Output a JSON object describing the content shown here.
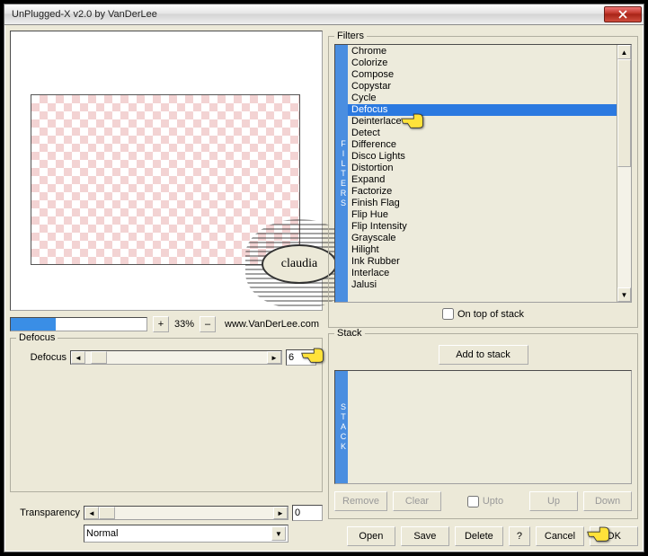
{
  "window": {
    "title": "UnPlugged-X v2.0 by VanDerLee"
  },
  "zoom": {
    "percent": "33%",
    "plus": "+",
    "minus": "–"
  },
  "url": "www.VanDerLee.com",
  "defocus_group": {
    "legend": "Defocus",
    "param_label": "Defocus",
    "value": "6"
  },
  "transparency": {
    "label": "Transparency",
    "value": "0",
    "mode": "Normal"
  },
  "filters": {
    "legend": "Filters",
    "side": "FILTERS",
    "items": [
      "Chrome",
      "Colorize",
      "Compose",
      "Copystar",
      "Cycle",
      "Defocus",
      "Deinterlace",
      "Detect",
      "Difference",
      "Disco Lights",
      "Distortion",
      "Expand",
      "Factorize",
      "Finish Flag",
      "Flip Hue",
      "Flip Intensity",
      "Grayscale",
      "Hilight",
      "Ink Rubber",
      "Interlace",
      "Jalusi"
    ],
    "selected_index": 5,
    "on_top_label": "On top of stack"
  },
  "stack": {
    "legend": "Stack",
    "side": "STACK",
    "add_label": "Add to stack",
    "remove": "Remove",
    "clear": "Clear",
    "upto": "Upto",
    "up": "Up",
    "down": "Down"
  },
  "buttons": {
    "open": "Open",
    "save": "Save",
    "delete": "Delete",
    "help": "?",
    "cancel": "Cancel",
    "ok": "OK"
  }
}
